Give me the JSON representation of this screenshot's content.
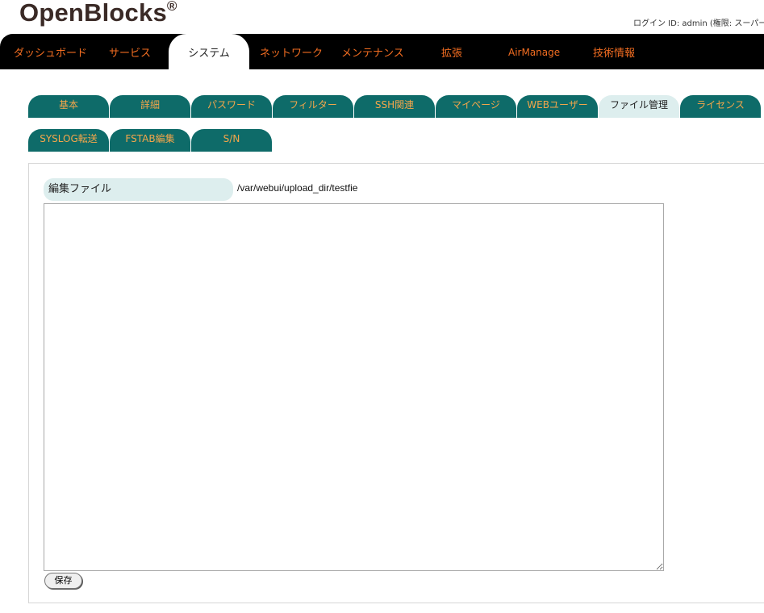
{
  "header": {
    "logo": "OpenBlocks",
    "logo_mark": "®",
    "login_info": "ログイン ID: admin (権限: スーパーユ"
  },
  "topnav": {
    "items": [
      {
        "label": "ダッシュボード"
      },
      {
        "label": "サービス"
      },
      {
        "label": "システム",
        "active": true
      },
      {
        "label": "ネットワーク"
      },
      {
        "label": "メンテナンス"
      },
      {
        "label": "拡張"
      },
      {
        "label": "AirManage"
      },
      {
        "label": "技術情報"
      }
    ]
  },
  "subtabs": {
    "row1": [
      {
        "label": "基本"
      },
      {
        "label": "詳細"
      },
      {
        "label": "パスワード"
      },
      {
        "label": "フィルター"
      },
      {
        "label": "SSH関連"
      },
      {
        "label": "マイページ"
      },
      {
        "label": "WEBユーザー"
      },
      {
        "label": "ファイル管理",
        "active": true
      },
      {
        "label": "ライセンス"
      }
    ],
    "row2": [
      {
        "label": "SYSLOG転送"
      },
      {
        "label": "FSTAB編集"
      },
      {
        "label": "S/N"
      }
    ]
  },
  "form": {
    "label": "編集ファイル",
    "file_path": "/var/webui/upload_dir/testfie",
    "content": "",
    "save_label": "保存"
  },
  "colors": {
    "nav_bg": "#000000",
    "nav_text": "#f26d21",
    "tab_bg": "#0e6b69",
    "tab_text": "#f5a64a",
    "tab_active_bg": "#ddeeee"
  }
}
